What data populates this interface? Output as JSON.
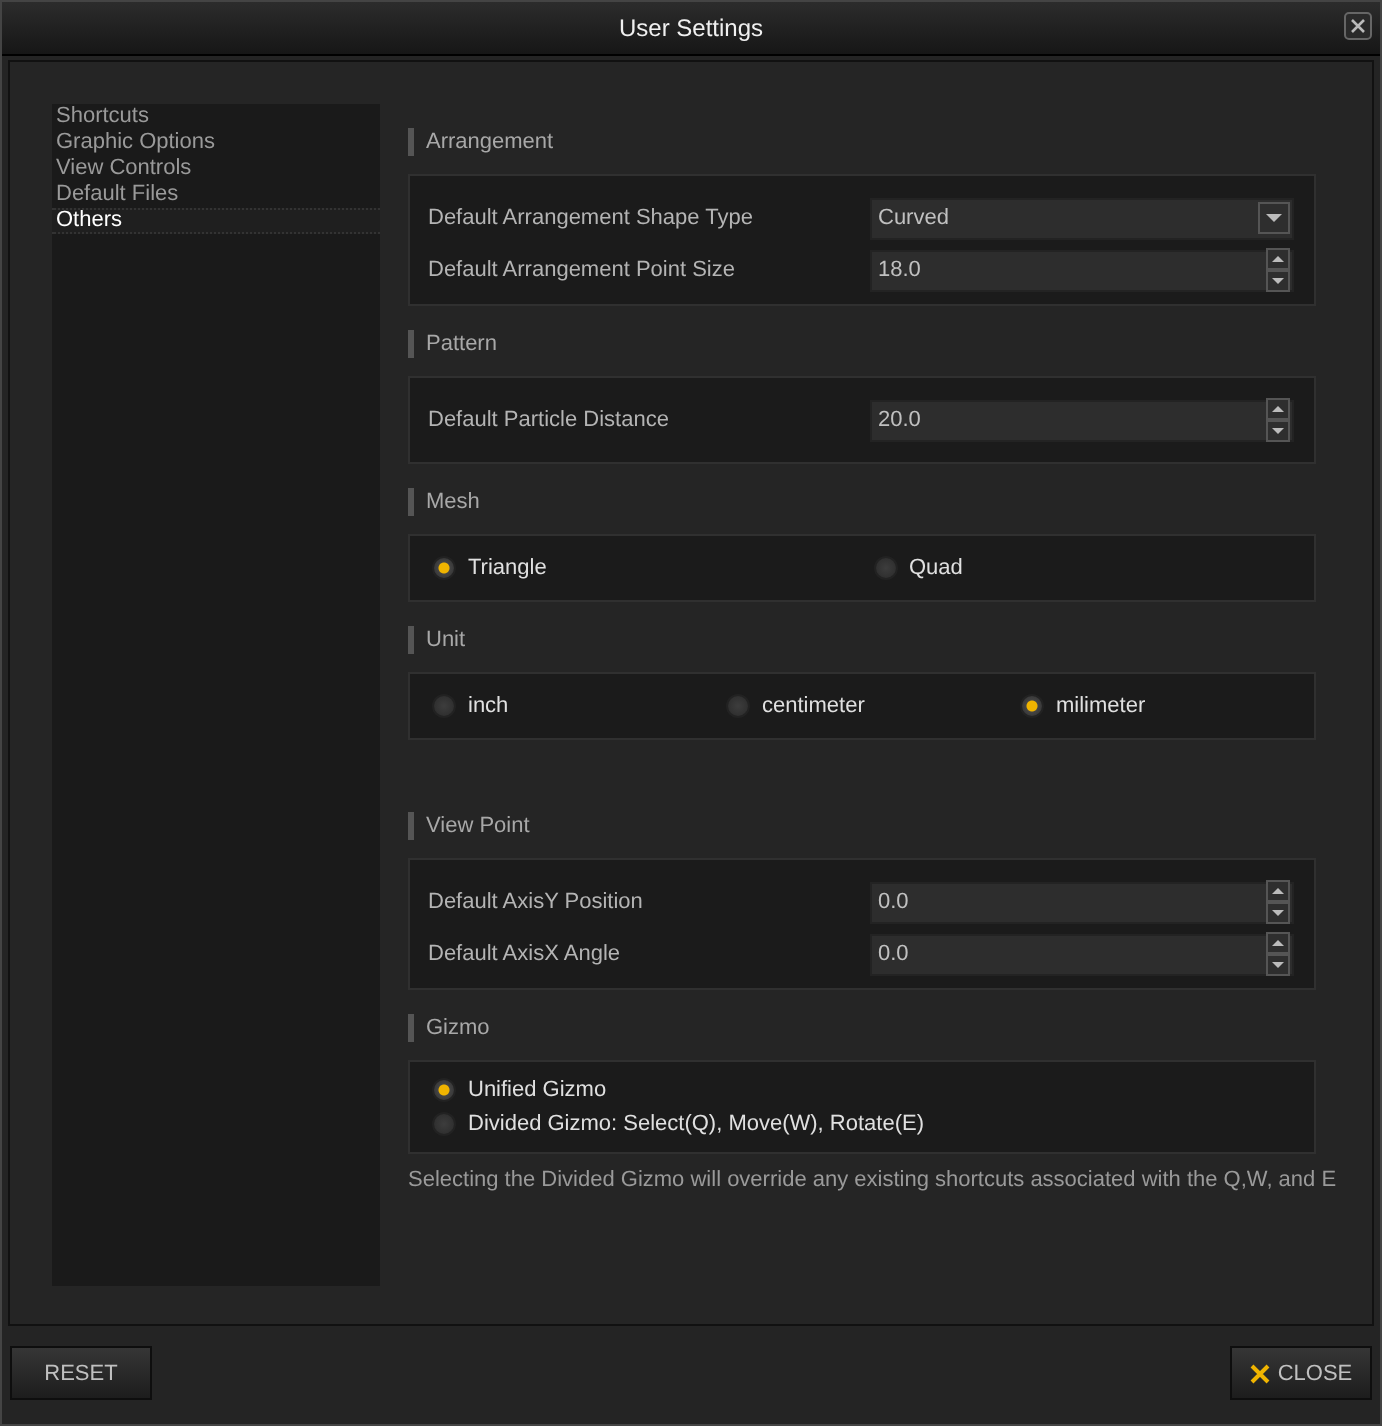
{
  "window": {
    "title": "User Settings"
  },
  "sidebar": {
    "items": [
      {
        "label": "Shortcuts",
        "selected": false
      },
      {
        "label": "Graphic Options",
        "selected": false
      },
      {
        "label": "View Controls",
        "selected": false
      },
      {
        "label": "Default Files",
        "selected": false
      },
      {
        "label": "Others",
        "selected": true
      }
    ]
  },
  "sections": [
    {
      "title": "Arrangement",
      "kind": "fields",
      "rows": [
        {
          "label": "Default Arrangement Shape Type",
          "kind": "dropdown",
          "value": "Curved"
        },
        {
          "label": "Default Arrangement Point Size",
          "kind": "spinner",
          "value": "18.0"
        }
      ]
    },
    {
      "title": "Pattern",
      "kind": "fields",
      "rows": [
        {
          "label": "Default Particle Distance",
          "kind": "spinner",
          "value": "20.0"
        }
      ]
    },
    {
      "title": "Mesh",
      "kind": "radiorow",
      "options": [
        {
          "label": "Triangle",
          "selected": true
        },
        {
          "label": "Quad",
          "selected": false
        }
      ]
    },
    {
      "title": "Unit",
      "kind": "radiorow",
      "options": [
        {
          "label": "inch",
          "selected": false
        },
        {
          "label": "centimeter",
          "selected": false
        },
        {
          "label": "milimeter",
          "selected": true
        }
      ]
    },
    {
      "title": "View Point",
      "kind": "fields",
      "rows": [
        {
          "label": "Default AxisY Position",
          "kind": "spinner",
          "value": "0.0"
        },
        {
          "label": "Default AxisX Angle",
          "kind": "spinner",
          "value": "0.0"
        }
      ]
    },
    {
      "title": "Gizmo",
      "kind": "radiolist",
      "options": [
        {
          "label": "Unified Gizmo",
          "selected": true
        },
        {
          "label": "Divided Gizmo: Select(Q), Move(W), Rotate(E)",
          "selected": false
        }
      ],
      "note": "Selecting the Divided Gizmo will override any existing shortcuts associated with the Q,W, and E"
    }
  ],
  "buttons": [
    {
      "label": "RESET",
      "kind": "plain"
    },
    {
      "label": "CLOSE",
      "kind": "close"
    }
  ]
}
